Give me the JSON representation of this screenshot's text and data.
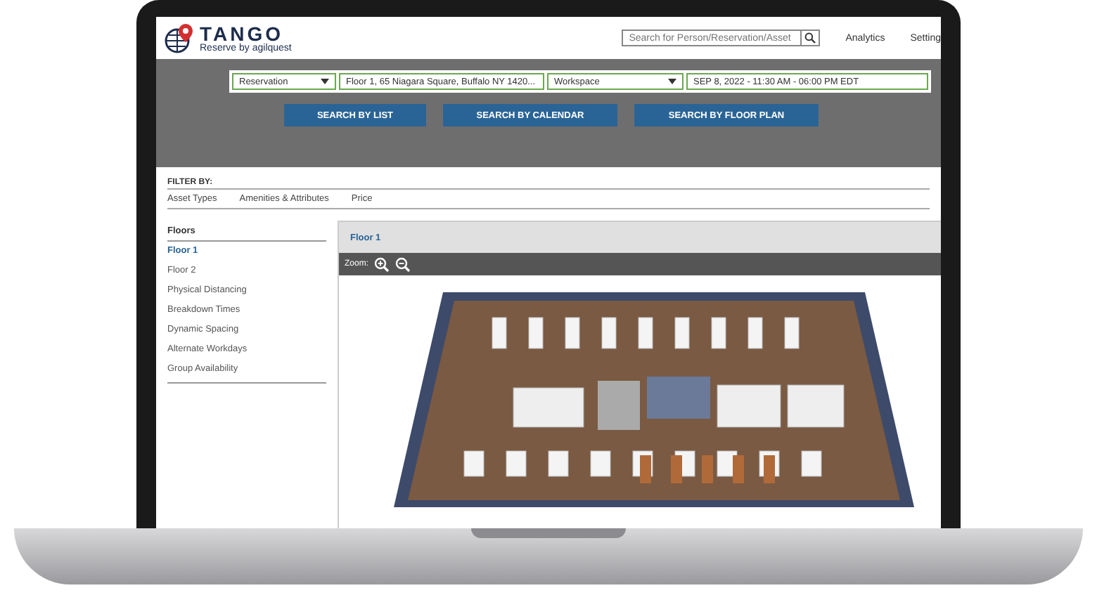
{
  "header": {
    "logo_title": "TANGO",
    "logo_subtitle": "Reserve by agilquest",
    "search": {
      "placeholder": "Search for Person/Reservation/Asset"
    },
    "nav": [
      "Analytics",
      "Setting"
    ]
  },
  "search_form": {
    "fields": [
      {
        "kind": "dropdown",
        "value": "Reservation"
      },
      {
        "kind": "clearable",
        "value": "Floor 1, 65 Niagara Square, Buffalo NY 1420..."
      },
      {
        "kind": "dropdown",
        "value": "Workspace"
      },
      {
        "kind": "text",
        "value": "SEP 8, 2022 - 11:30 AM - 06:00 PM EDT"
      }
    ],
    "buttons": [
      "SEARCH BY LIST",
      "SEARCH BY CALENDAR",
      "SEARCH BY FLOOR PLAN"
    ]
  },
  "filter": {
    "label": "FILTER BY:",
    "tabs": [
      "Asset Types",
      "Amenities & Attributes",
      "Price"
    ]
  },
  "sidebar": {
    "heading": "Floors",
    "items": [
      {
        "label": "Floor 1",
        "selected": true
      },
      {
        "label": "Floor 2",
        "selected": false
      },
      {
        "label": "Physical Distancing",
        "selected": false
      },
      {
        "label": "Breakdown Times",
        "selected": false
      },
      {
        "label": "Dynamic Spacing",
        "selected": false
      },
      {
        "label": "Alternate Workdays",
        "selected": false
      },
      {
        "label": "Group Availability",
        "selected": false
      }
    ]
  },
  "main": {
    "title": "Floor 1",
    "zoom_label": "Zoom:"
  }
}
